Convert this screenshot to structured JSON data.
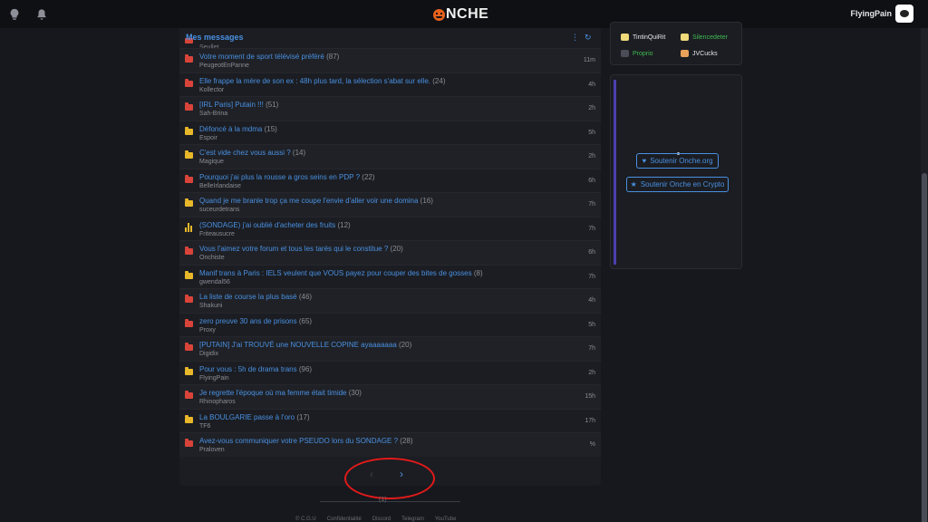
{
  "topbar": {
    "logo_text": "NCHE",
    "username": "FlyingPain"
  },
  "panel": {
    "title": "Mes messages",
    "peek_author": "Seullet",
    "topics": [
      {
        "title": "Votre moment de sport télévisé préféré",
        "count": "(87)",
        "author": "PeugeotEnPanne",
        "time": "11m",
        "icon": "red"
      },
      {
        "title": "Elle frappe la mère de son ex : 48h plus tard, la sélection s'abat sur elle.",
        "count": "(24)",
        "author": "Kollector",
        "time": "4h",
        "icon": "red"
      },
      {
        "title": "[IRL Paris] Putain !!!",
        "count": "(51)",
        "author": "Sah-Brina",
        "time": "2h",
        "icon": "red"
      },
      {
        "title": "Défoncé à la mdma",
        "count": "(15)",
        "author": "Espoir",
        "time": "5h",
        "icon": "yellow"
      },
      {
        "title": "C'est vide chez vous aussi ?",
        "count": "(14)",
        "author": "Magique",
        "time": "2h",
        "icon": "yellow"
      },
      {
        "title": "Pourquoi j'ai plus la rousse a gros seins en PDP ?",
        "count": "(22)",
        "author": "BelleIrlandaise",
        "time": "6h",
        "icon": "red"
      },
      {
        "title": "Quand je me branle trop ça me coupe l'envie d'aller voir une domina",
        "count": "(16)",
        "author": "suceurdetrans",
        "time": "7h",
        "icon": "yellow"
      },
      {
        "title": "(SONDAGE) j'ai oublié d'acheter des fruits",
        "count": "(12)",
        "author": "Friteausucre",
        "time": "7h",
        "icon": "poll"
      },
      {
        "title": "Vous l'aimez votre forum et tous les tarés qui le constitue ?",
        "count": "(20)",
        "author": "Onchiste",
        "time": "6h",
        "icon": "red"
      },
      {
        "title": "Manif trans à Paris : IELS veulent que VOUS payez pour couper des bites de gosses",
        "count": "(8)",
        "author": "gwendal56",
        "time": "7h",
        "icon": "yellow"
      },
      {
        "title": "La liste de course la plus basé",
        "count": "(46)",
        "author": "Shakuni",
        "time": "4h",
        "icon": "red"
      },
      {
        "title": "zero preuve 30 ans de prisons",
        "count": "(65)",
        "author": "Proxy",
        "time": "5h",
        "icon": "red"
      },
      {
        "title": "[PUTAIN] J'ai TROUVÉ une NOUVELLE COPINE ayaaaaaaa",
        "count": "(20)",
        "author": "Digidix",
        "time": "7h",
        "icon": "red"
      },
      {
        "title": "Pour vous : 5h de drama trans",
        "count": "(96)",
        "author": "FlyingPain",
        "time": "2h",
        "icon": "yellow"
      },
      {
        "title": "Je regrette l'époque où ma femme était timide",
        "count": "(30)",
        "author": "Rhinopharos",
        "time": "15h",
        "icon": "red"
      },
      {
        "title": "La BOULGARIE passe à l'oro",
        "count": "(17)",
        "author": "TF6",
        "time": "17h",
        "icon": "yellow"
      },
      {
        "title": "Avez-vous communiquer votre PSEUDO lors du SONDAGE ?",
        "count": "(28)",
        "author": "Praloven",
        "time": "%",
        "icon": "red"
      }
    ],
    "pager": {
      "prev": "‹",
      "next": "›"
    }
  },
  "footer": {
    "number": "(1)",
    "links": [
      "© C.G.U",
      "Confidentialité",
      "Discord",
      "Telegram",
      "YouTube"
    ]
  },
  "sidebar": {
    "users": [
      {
        "name": "TintinQuiRit",
        "color": "#e5e6ea"
      },
      {
        "name": "Silencedeter",
        "color": "#3fb950"
      },
      {
        "name": "Proprio",
        "color": "#3fb950"
      },
      {
        "name": "JVCucks",
        "color": "#e5e6ea"
      }
    ],
    "buttons": {
      "support_onche": "Soutenir Onche.org",
      "support_crypto": "Soutenir Onche en Crypto"
    }
  }
}
